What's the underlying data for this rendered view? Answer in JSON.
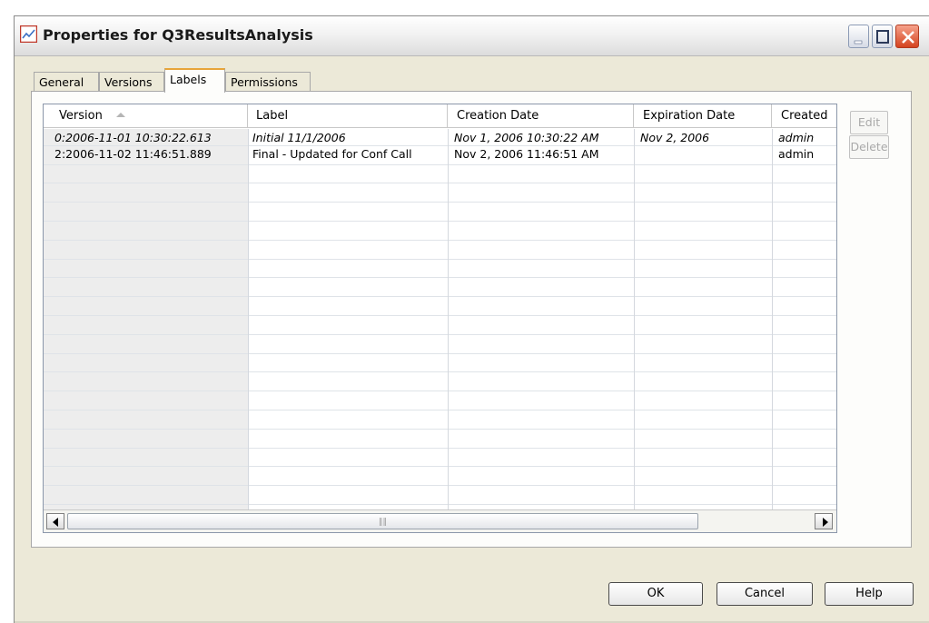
{
  "window": {
    "title": "Properties for Q3ResultsAnalysis"
  },
  "tabs": [
    {
      "label": "General"
    },
    {
      "label": "Versions"
    },
    {
      "label": "Labels",
      "active": true
    },
    {
      "label": "Permissions"
    }
  ],
  "table": {
    "columns": [
      "Version",
      "Label",
      "Creation Date",
      "Expiration Date",
      "Created"
    ],
    "sort_column": "Version",
    "sort_direction": "ascending",
    "rows": [
      {
        "version": "0:2006-11-01 10:30:22.613",
        "label": "Initial 11/1/2006",
        "creation_date": "Nov 1, 2006 10:30:22 AM",
        "expiration_date": "Nov 2, 2006",
        "created_by": "admin",
        "italic": true
      },
      {
        "version": "2:2006-11-02 11:46:51.889",
        "label": "Final - Updated for Conf Call",
        "creation_date": "Nov 2, 2006 11:46:51 AM",
        "expiration_date": "",
        "created_by": "admin",
        "italic": false
      }
    ]
  },
  "side_buttons": {
    "edit": "Edit",
    "delete": "Delete"
  },
  "footer_buttons": {
    "ok": "OK",
    "cancel": "Cancel",
    "help": "Help"
  },
  "colors": {
    "dialog_bg": "#ece9d8",
    "active_tab_accent": "#e8a53a",
    "close_button": "#d4431f",
    "disabled_text": "#a9a9a9"
  },
  "icons": {
    "app": "chart-icon",
    "minimize": "minimize-icon",
    "maximize": "maximize-icon",
    "close": "close-icon",
    "sort": "sort-ascending-icon",
    "scroll_left": "arrow-left-icon",
    "scroll_right": "arrow-right-icon"
  }
}
